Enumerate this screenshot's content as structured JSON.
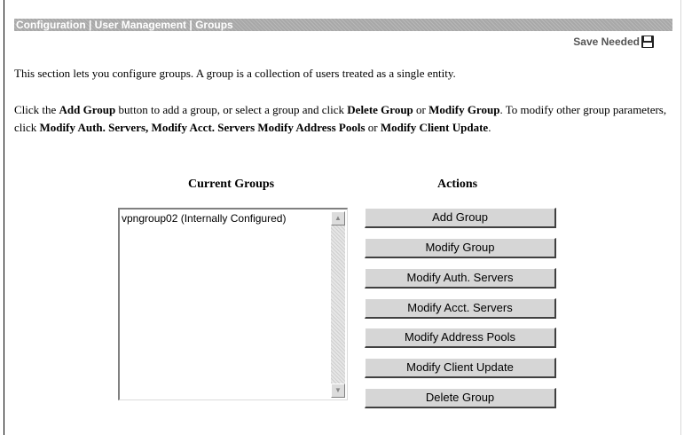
{
  "header": {
    "breadcrumb": "Configuration | User Management | Groups",
    "save_needed": "Save Needed"
  },
  "intro": {
    "text": "This section lets you configure groups. A group is a collection of users treated as a single entity."
  },
  "instructions": {
    "t1": "Click the ",
    "b1": "Add Group",
    "t2": " button to add a group, or select a group and click ",
    "b2": "Delete Group",
    "t3": " or ",
    "b3": "Modify Group",
    "t4": ". To modify other group parameters, click ",
    "b4": "Modify Auth. Servers,",
    "t5": " ",
    "b5": "Modify Acct. Servers",
    "t6": " ",
    "b6": "Modify Address Pools",
    "t7": " or ",
    "b7": "Modify Client Update",
    "t8": "."
  },
  "groups": {
    "heading": "Current Groups",
    "items": [
      "vpngroup02 (Internally Configured)"
    ]
  },
  "actions": {
    "heading": "Actions",
    "buttons": [
      "Add Group",
      "Modify Group",
      "Modify Auth. Servers",
      "Modify Acct. Servers",
      "Modify Address Pools",
      "Modify Client Update",
      "Delete Group"
    ]
  },
  "icons": {
    "save": "floppy-disk-icon",
    "scroll_up": "arrow-up-icon",
    "scroll_down": "arrow-down-icon"
  }
}
